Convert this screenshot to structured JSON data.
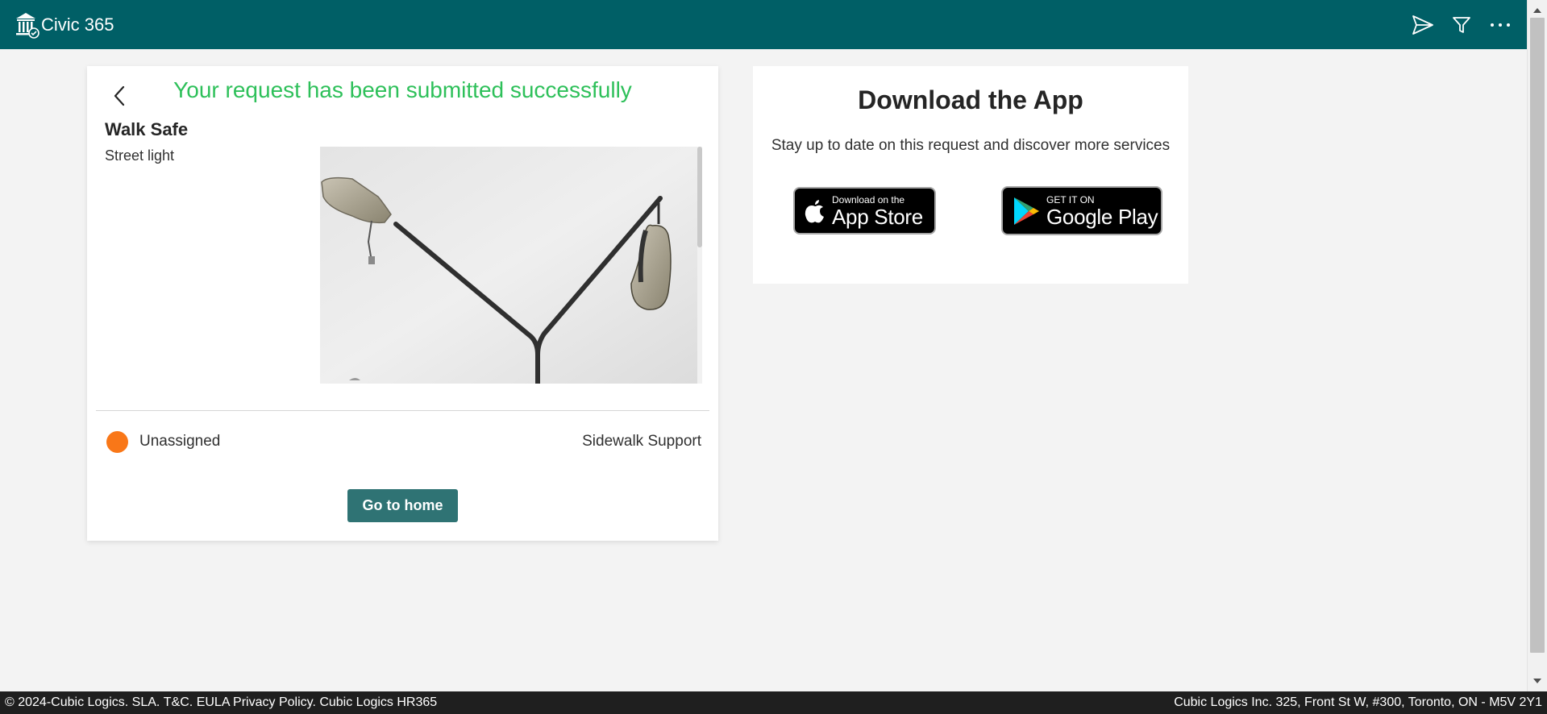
{
  "header": {
    "app_name": "Civic 365",
    "icons": [
      "bank-logo-icon",
      "send-icon",
      "filter-icon",
      "more-icon"
    ]
  },
  "request": {
    "success_message": "Your request has been submitted successfully",
    "service_name": "Walk Safe",
    "service_type": "Street light",
    "photo_subject": "street-light-photo",
    "status": "Unassigned",
    "status_color": "#f97718",
    "department": "Sidewalk Support",
    "home_button_label": "Go to home"
  },
  "download": {
    "title": "Download the App",
    "subtitle": "Stay up to date on this request and discover more services",
    "apple_small": "Download on the",
    "apple_big": "App Store",
    "google_small": "GET IT ON",
    "google_big": "Google Play"
  },
  "footer": {
    "copyright": "© 2024-Cubic Logics. ",
    "sla": "SLA. ",
    "tc": "T&C. ",
    "eula": "EULA ",
    "privacy": "Privacy Policy. ",
    "hr365": "Cubic Logics HR365",
    "address": "Cubic Logics Inc. 325, Front St W, #300, Toronto, ON - M5V 2Y1"
  },
  "colors": {
    "header_bg": "#005f66",
    "success": "#2ec05a",
    "button_bg": "#2f7374",
    "page_bg": "#f3f3f3"
  }
}
